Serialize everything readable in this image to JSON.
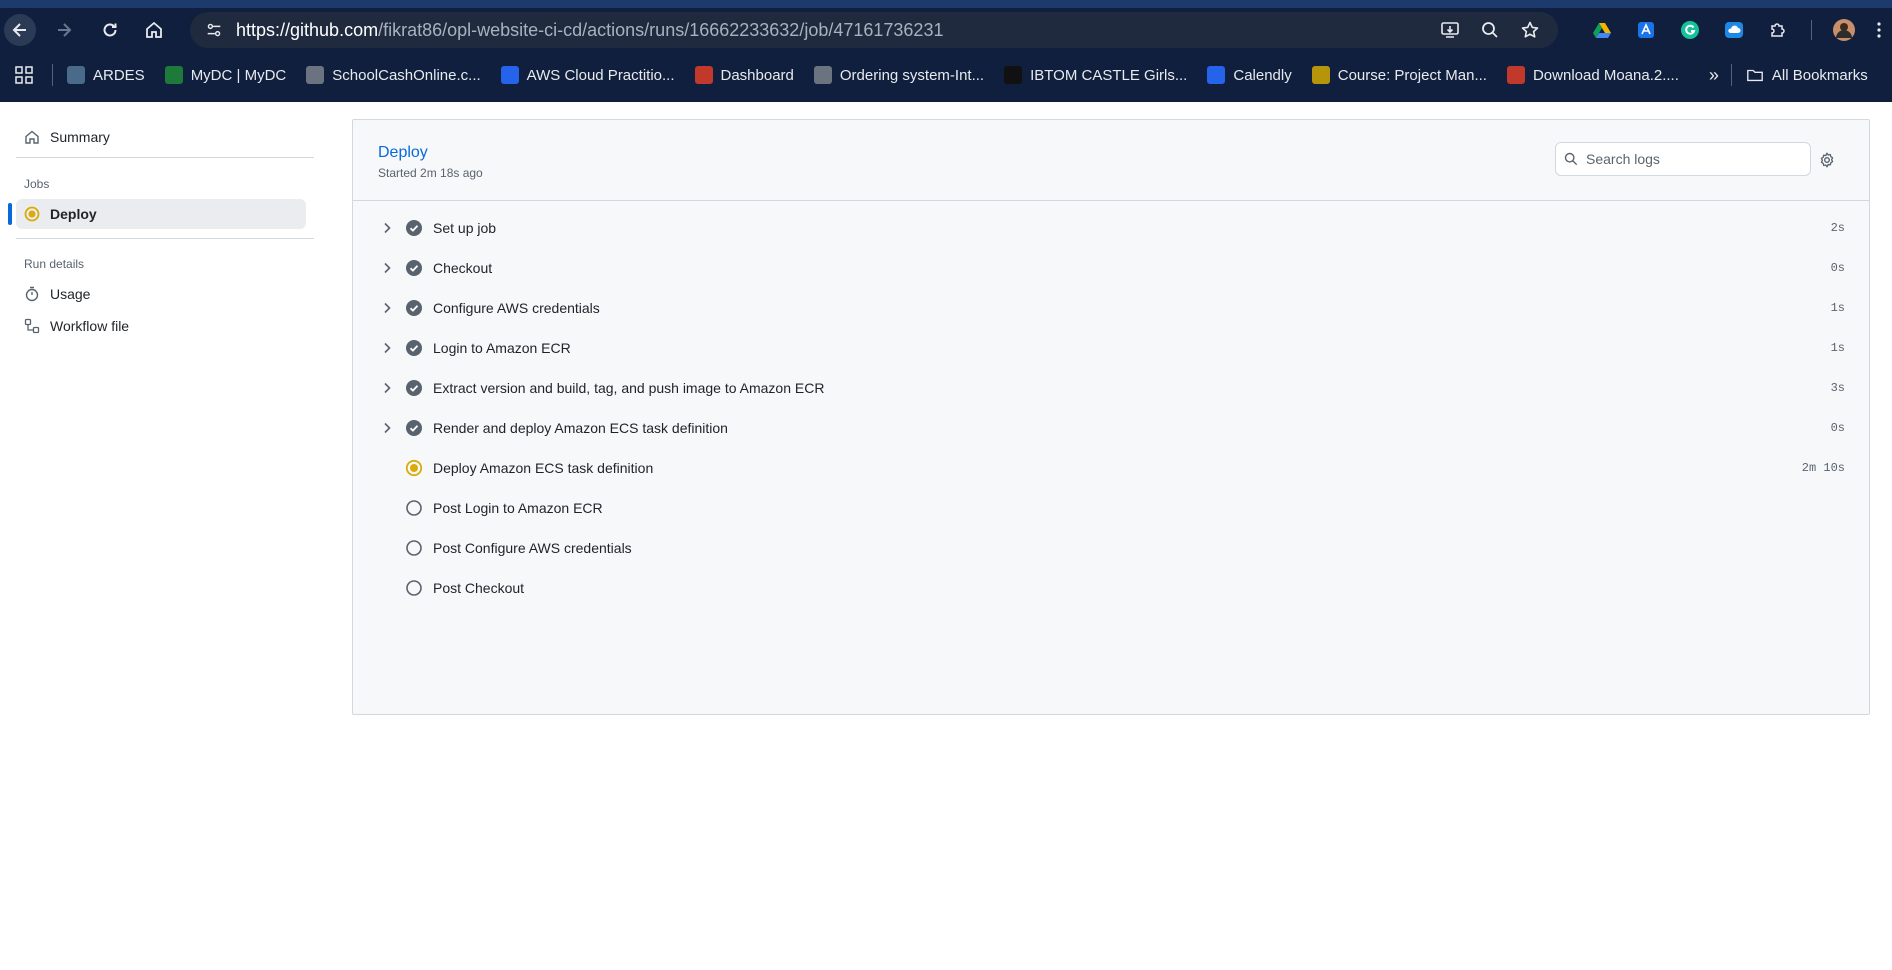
{
  "browser": {
    "url_host": "https://github.com",
    "url_path": "/fikrat86/opl-website-ci-cd/actions/runs/16662233632/job/47161736231",
    "bookmarks": [
      {
        "label": "ARDES",
        "color": "#4a6a8a"
      },
      {
        "label": "MyDC | MyDC",
        "color": "#1e7a3a"
      },
      {
        "label": "SchoolCashOnline.c...",
        "color": "#6b7280"
      },
      {
        "label": "AWS Cloud Practitio...",
        "color": "#2563eb"
      },
      {
        "label": "Dashboard",
        "color": "#c0392b"
      },
      {
        "label": "Ordering system-Int...",
        "color": "#6b7280"
      },
      {
        "label": "IBTOM CASTLE Girls...",
        "color": "#111111"
      },
      {
        "label": "Calendly",
        "color": "#2563eb"
      },
      {
        "label": "Course: Project Man...",
        "color": "#b7950b"
      },
      {
        "label": "Download Moana.2....",
        "color": "#c0392b"
      }
    ],
    "more_bookmarks": "»",
    "all_bookmarks": "All Bookmarks"
  },
  "sidebar": {
    "summary": "Summary",
    "jobs_heading": "Jobs",
    "job_deploy": "Deploy",
    "run_details_heading": "Run details",
    "usage": "Usage",
    "workflow_file": "Workflow file"
  },
  "job": {
    "title": "Deploy",
    "started": "Started 2m 18s ago",
    "search_placeholder": "Search logs"
  },
  "steps": [
    {
      "name": "Set up job",
      "status": "success",
      "duration": "2s",
      "expandable": true
    },
    {
      "name": "Checkout",
      "status": "success",
      "duration": "0s",
      "expandable": true
    },
    {
      "name": "Configure AWS credentials",
      "status": "success",
      "duration": "1s",
      "expandable": true
    },
    {
      "name": "Login to Amazon ECR",
      "status": "success",
      "duration": "1s",
      "expandable": true
    },
    {
      "name": "Extract version and build, tag, and push image to Amazon ECR",
      "status": "success",
      "duration": "3s",
      "expandable": true
    },
    {
      "name": "Render and deploy Amazon ECS task definition",
      "status": "success",
      "duration": "0s",
      "expandable": true
    },
    {
      "name": "Deploy Amazon ECS task definition",
      "status": "in_progress",
      "duration": "2m 10s",
      "expandable": false
    },
    {
      "name": "Post Login to Amazon ECR",
      "status": "pending",
      "duration": "",
      "expandable": false
    },
    {
      "name": "Post Configure AWS credentials",
      "status": "pending",
      "duration": "",
      "expandable": false
    },
    {
      "name": "Post Checkout",
      "status": "pending",
      "duration": "",
      "expandable": false
    }
  ],
  "colors": {
    "success": "#59636e",
    "in_progress": "#dbab0a",
    "link": "#0969da"
  }
}
